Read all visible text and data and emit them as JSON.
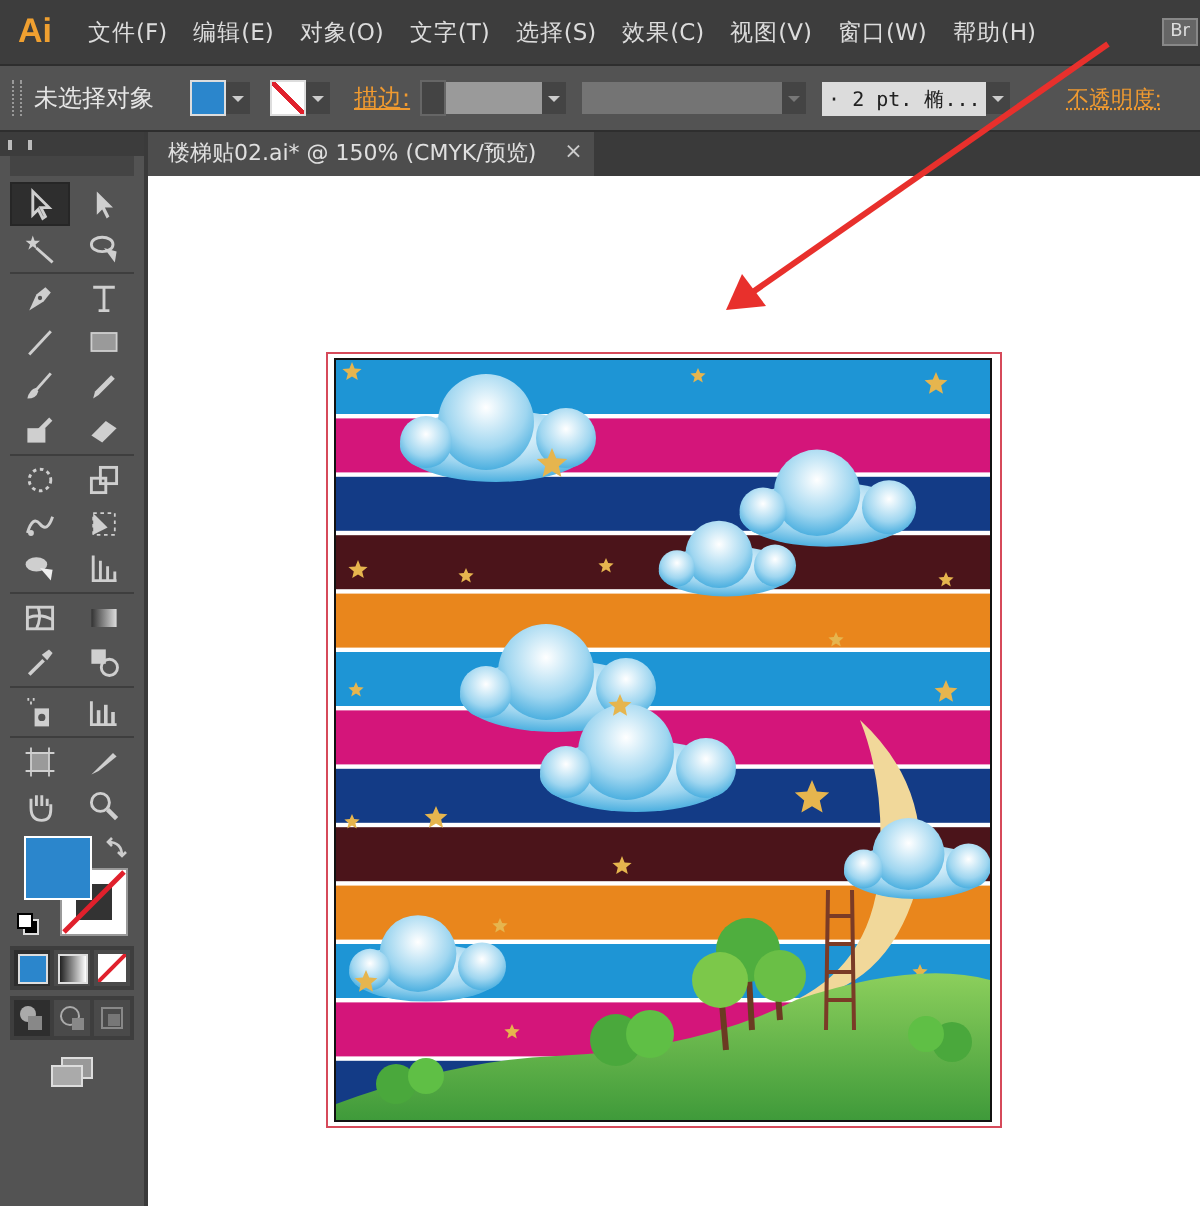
{
  "app": {
    "logo": "Ai",
    "bridge_button": "Br"
  },
  "menu": [
    "文件(F)",
    "编辑(E)",
    "对象(O)",
    "文字(T)",
    "选择(S)",
    "效果(C)",
    "视图(V)",
    "窗口(W)",
    "帮助(H)"
  ],
  "control_bar": {
    "selection_label": "未选择对象",
    "stroke_label": "描边:",
    "brush_field": "·  2 pt. 椭...",
    "opacity_label": "不透明度:"
  },
  "document_tab": {
    "title": "楼梯贴02.ai* @ 150% (CMYK/预览)",
    "close": "×"
  },
  "tools": [
    {
      "kind": "select",
      "selected": true
    },
    {
      "kind": "direct",
      "selected": false
    },
    {
      "kind": "wand",
      "selected": false
    },
    {
      "kind": "lasso",
      "selected": false
    },
    {
      "kind": "pen",
      "selected": false
    },
    {
      "kind": "type",
      "selected": false
    },
    {
      "kind": "line",
      "selected": false
    },
    {
      "kind": "rect",
      "selected": false
    },
    {
      "kind": "brush",
      "selected": false
    },
    {
      "kind": "pencil",
      "selected": false
    },
    {
      "kind": "blob",
      "selected": false
    },
    {
      "kind": "eraser",
      "selected": false
    },
    {
      "kind": "rotate",
      "selected": false
    },
    {
      "kind": "scale",
      "selected": false
    },
    {
      "kind": "warp",
      "selected": false
    },
    {
      "kind": "transform",
      "selected": false
    },
    {
      "kind": "builder",
      "selected": false
    },
    {
      "kind": "perspective",
      "selected": false
    },
    {
      "kind": "mesh",
      "selected": false
    },
    {
      "kind": "gradient",
      "selected": false
    },
    {
      "kind": "eyedropper",
      "selected": false
    },
    {
      "kind": "blend",
      "selected": false
    },
    {
      "kind": "sprayer",
      "selected": false
    },
    {
      "kind": "graph",
      "selected": false
    },
    {
      "kind": "artboard",
      "selected": false
    },
    {
      "kind": "slice",
      "selected": false
    },
    {
      "kind": "hand",
      "selected": false
    },
    {
      "kind": "zoom",
      "selected": false
    }
  ],
  "draw_modes": [
    {
      "kind": "normal",
      "selected": true
    },
    {
      "kind": "behind",
      "selected": false
    },
    {
      "kind": "inside",
      "selected": false
    }
  ]
}
